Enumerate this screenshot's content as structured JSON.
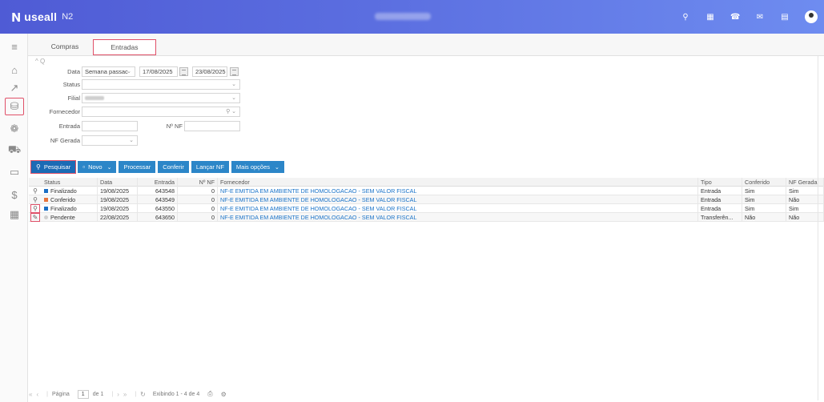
{
  "header": {
    "logo_mark": "ɴ",
    "logo_text": "useall",
    "logo_version": "N2",
    "icons": [
      "search-icon",
      "grid-icon",
      "user-icon",
      "mail-icon",
      "chat-icon",
      "avatar"
    ]
  },
  "sidebar": {
    "items": [
      {
        "name": "menu-icon",
        "glyph": "≡"
      },
      {
        "name": "home-icon",
        "glyph": "⌂"
      },
      {
        "name": "chart-icon",
        "glyph": "↗"
      },
      {
        "name": "basket-icon",
        "glyph": "⛁"
      },
      {
        "name": "coins-icon",
        "glyph": "❁"
      },
      {
        "name": "cart-icon",
        "glyph": "⛟"
      },
      {
        "name": "card-icon",
        "glyph": "▭"
      },
      {
        "name": "dollar-icon",
        "glyph": "$"
      },
      {
        "name": "calculator-icon",
        "glyph": "▦"
      }
    ]
  },
  "tabs": [
    {
      "label": "Compras"
    },
    {
      "label": "Entradas"
    }
  ],
  "filters": {
    "toggle": "^ Q",
    "date_label": "Data",
    "date_period": "Semana passac",
    "date_from": "17/08/2025",
    "date_to": "23/08/2025",
    "status_label": "Status",
    "filial_label": "Filial",
    "fornecedor_label": "Fornecedor",
    "entrada_label": "Entrada",
    "nf_label": "Nº NF",
    "nf_gerada_label": "NF Gerada"
  },
  "toolbar": {
    "search": "Pesquisar",
    "new": "Novo",
    "process": "Processar",
    "check": "Conferir",
    "launch": "Lançar NF",
    "more": "Mais opções"
  },
  "grid": {
    "columns": [
      "Status",
      "Data",
      "Entrada",
      "Nº NF",
      "Fornecedor",
      "Tipo",
      "Conferido",
      "NF Gerada"
    ],
    "rows": [
      {
        "status": "Finalizado",
        "status_color": "#1c6fc4",
        "data": "19/08/2025",
        "entrada": "643548",
        "nf": "0",
        "fornecedor": "NF-E EMITIDA EM AMBIENTE DE HOMOLOGACAO - SEM VALOR FISCAL",
        "tipo": "Entrada",
        "conferido": "Sim",
        "nf_gerada": "Sim"
      },
      {
        "status": "Conferido",
        "status_color": "#e8743b",
        "data": "19/08/2025",
        "entrada": "643549",
        "nf": "0",
        "fornecedor": "NF-E EMITIDA EM AMBIENTE DE HOMOLOGACAO - SEM VALOR FISCAL",
        "tipo": "Entrada",
        "conferido": "Sim",
        "nf_gerada": "Não"
      },
      {
        "status": "Finalizado",
        "status_color": "#1c6fc4",
        "data": "19/08/2025",
        "entrada": "643550",
        "nf": "0",
        "fornecedor": "NF-E EMITIDA EM AMBIENTE DE HOMOLOGACAO - SEM VALOR FISCAL",
        "tipo": "Entrada",
        "conferido": "Sim",
        "nf_gerada": "Sim"
      },
      {
        "status": "Pendente",
        "status_color": "#cfcfcf",
        "data": "22/08/2025",
        "entrada": "643650",
        "nf": "0",
        "fornecedor": "NF-E EMITIDA EM AMBIENTE DE HOMOLOGACAO - SEM VALOR FISCAL",
        "tipo": "Transferên...",
        "conferido": "Não",
        "nf_gerada": "Não"
      }
    ]
  },
  "pager": {
    "page_label": "Página",
    "page_value": "1",
    "of_label": "de 1",
    "showing": "Exibindo 1 - 4 de 4"
  },
  "colors": {
    "header_start": "#4f5bd5",
    "header_end": "#6e8cf0",
    "button": "#2c86c8",
    "highlight": "#e05068",
    "link": "#1a73c8"
  }
}
